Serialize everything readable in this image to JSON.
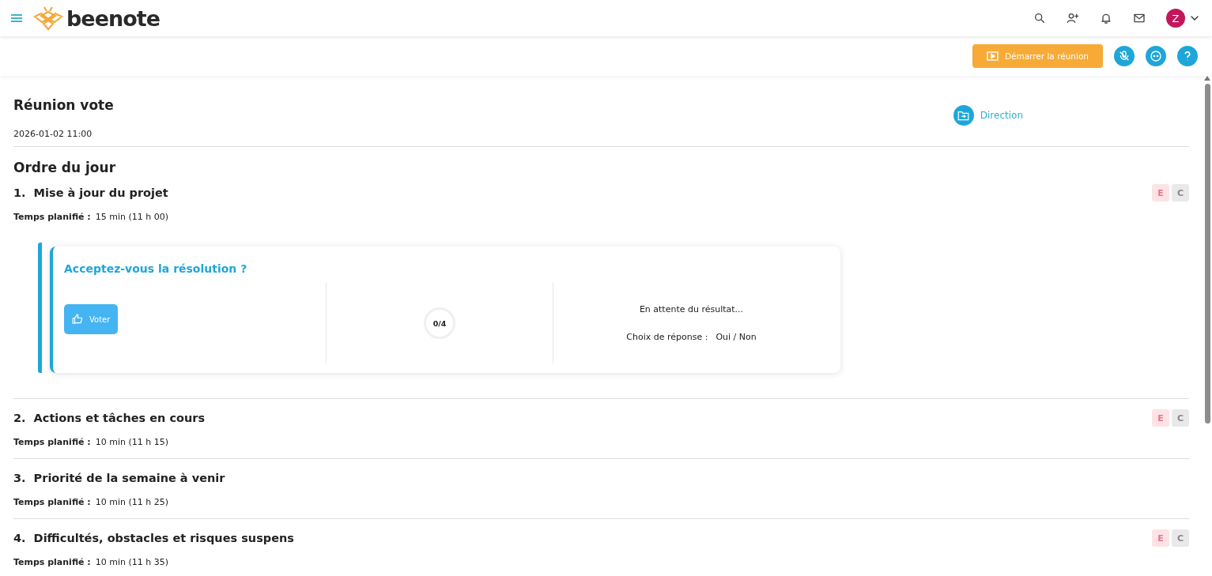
{
  "header": {
    "logo": "beenote",
    "avatar": "Z"
  },
  "toolbar": {
    "start_button": "Démarrer la réunion"
  },
  "meeting": {
    "title": "Réunion vote",
    "date": "2026-01-02 11:00",
    "folder": "Direction"
  },
  "agenda": {
    "title": "Ordre du jour",
    "items": [
      {
        "number": "1.",
        "title": "Mise à jour du projet",
        "time_label": "Temps planifié :",
        "time": "15 min (11 h 00)",
        "badges": [
          "E",
          "C"
        ],
        "vote": {
          "question": "Acceptez-vous la résolution ?",
          "button": "Voter",
          "count": "0/4",
          "status": "En attente du résultat...",
          "choice_label": "Choix de réponse :",
          "choices": "Oui / Non"
        }
      },
      {
        "number": "2.",
        "title": "Actions et tâches en cours",
        "time_label": "Temps planifié :",
        "time": "10 min (11 h 15)",
        "badges": [
          "E",
          "C"
        ]
      },
      {
        "number": "3.",
        "title": "Priorité de la semaine à venir",
        "time_label": "Temps planifié :",
        "time": "10 min (11 h 25)"
      },
      {
        "number": "4.",
        "title": "Difficultés, obstacles et risques suspens",
        "time_label": "Temps planifié :",
        "time": "10 min (11 h 35)",
        "badges": [
          "E",
          "C"
        ]
      }
    ]
  }
}
